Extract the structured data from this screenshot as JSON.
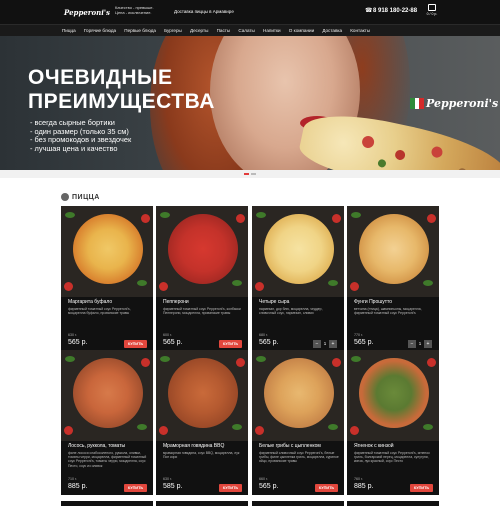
{
  "header": {
    "logo_text": "Pepperoni's",
    "slogan_line1": "Качество - превыше.",
    "slogan_line2": "Цена - исключение.",
    "delivery_text": "Доставка пиццы в Армавире",
    "phone": "8 918 180-22-88",
    "cart_label": "0 / 0 р."
  },
  "nav": {
    "items": [
      "Пицца",
      "Горячие блюда",
      "Первые блюда",
      "Бургеры",
      "Десерты",
      "Пасты",
      "Салаты",
      "Напитки",
      "О компании",
      "Доставка",
      "Контакты"
    ]
  },
  "hero": {
    "title_line1": "ОЧЕВИДНЫЕ",
    "title_line2": "ПРЕИМУЩЕСТВА",
    "benefits": [
      "- всегда сырные бортики",
      "- один размер (только 35 см)",
      "- без промокодов и звездочек",
      "- лучшая цена и качество"
    ],
    "logo_text": "Pepperoni's"
  },
  "section": {
    "title": "ПИЦЦА"
  },
  "products": [
    {
      "name": "Маргарита буфало",
      "desc": "фирменный томатный соус Pepperoni's, моцарелла буфало, прованские травы",
      "weight": "630 г.",
      "price": "565 р.",
      "buy": "КУПИТЬ"
    },
    {
      "name": "Пепперони",
      "desc": "фирменный томатный соус Pepperoni's, колбаски Пепперони, моцарелла, прованские травы",
      "weight": "600 г.",
      "price": "565 р.",
      "buy": "КУПИТЬ"
    },
    {
      "name": "Четыре сыра",
      "desc": "пармезан, дор блю, моцарелла, чеддер, сливочный соус, пармезан, сливки",
      "weight": "680 г.",
      "price": "565 р.",
      "buy": "",
      "qty": "1",
      "minus": "−",
      "plus": "+"
    },
    {
      "name": "Фунги Прошутто",
      "desc": "ветчина (птица), шампиньоны, моцарелла, фирменный томатный соус Pepperoni's",
      "weight": "770 г.",
      "price": "565 р.",
      "buy": "",
      "qty": "1",
      "minus": "−",
      "plus": "+"
    },
    {
      "name": "Лосось, руккола, томаты",
      "desc": "филе лосося слабосоленого, руккола, оливки, томаты черри, моцарелла, фирменный томатный соус Pepperoni's, томаты черри, моцарелла, соус Песто, соус из оливок",
      "weight": "710 г.",
      "price": "885 р.",
      "buy": "КУПИТЬ"
    },
    {
      "name": "Мраморная говядина BBQ",
      "desc": "мраморная говядина, соус BBQ, моцарелла, лук Пон кори",
      "weight": "630 г.",
      "price": "585 р.",
      "buy": "КУПИТЬ"
    },
    {
      "name": "Белые грибы с цыпленком",
      "desc": "фирменный сливочный соус Pepperoni's, белые грибы, филе цыпленка гриль, моцарелла, куриное яйцо, прованские травы",
      "weight": "660 г.",
      "price": "565 р.",
      "buy": "КУПИТЬ"
    },
    {
      "name": "Ягненок с кинзой",
      "desc": "фирменный томатный соус Pepperoni's, ягненок гриль, болгарский перец, моцарелла, сулугуни, кинза, лук красный, соус Песто",
      "weight": "760 г.",
      "price": "885 р.",
      "buy": "КУПИТЬ"
    }
  ],
  "colors": {
    "accent": "#e2473d",
    "header_bg": "#111111",
    "card_bg": "#111111"
  }
}
